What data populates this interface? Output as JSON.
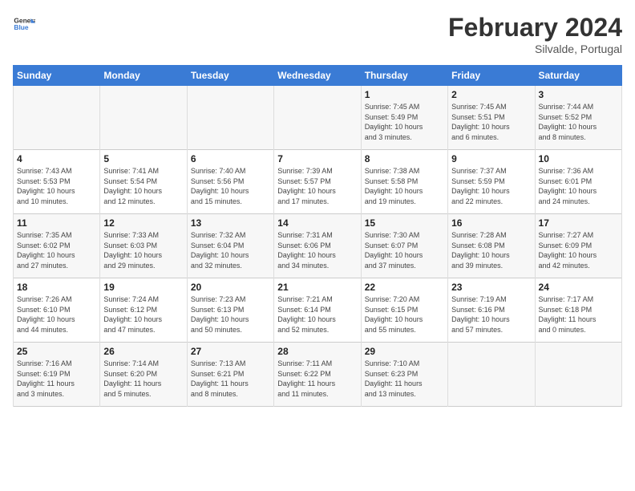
{
  "header": {
    "logo_general": "General",
    "logo_blue": "Blue",
    "month_title": "February 2024",
    "subtitle": "Silvalde, Portugal"
  },
  "weekdays": [
    "Sunday",
    "Monday",
    "Tuesday",
    "Wednesday",
    "Thursday",
    "Friday",
    "Saturday"
  ],
  "weeks": [
    [
      {
        "day": "",
        "info": ""
      },
      {
        "day": "",
        "info": ""
      },
      {
        "day": "",
        "info": ""
      },
      {
        "day": "",
        "info": ""
      },
      {
        "day": "1",
        "info": "Sunrise: 7:45 AM\nSunset: 5:49 PM\nDaylight: 10 hours\nand 3 minutes."
      },
      {
        "day": "2",
        "info": "Sunrise: 7:45 AM\nSunset: 5:51 PM\nDaylight: 10 hours\nand 6 minutes."
      },
      {
        "day": "3",
        "info": "Sunrise: 7:44 AM\nSunset: 5:52 PM\nDaylight: 10 hours\nand 8 minutes."
      }
    ],
    [
      {
        "day": "4",
        "info": "Sunrise: 7:43 AM\nSunset: 5:53 PM\nDaylight: 10 hours\nand 10 minutes."
      },
      {
        "day": "5",
        "info": "Sunrise: 7:41 AM\nSunset: 5:54 PM\nDaylight: 10 hours\nand 12 minutes."
      },
      {
        "day": "6",
        "info": "Sunrise: 7:40 AM\nSunset: 5:56 PM\nDaylight: 10 hours\nand 15 minutes."
      },
      {
        "day": "7",
        "info": "Sunrise: 7:39 AM\nSunset: 5:57 PM\nDaylight: 10 hours\nand 17 minutes."
      },
      {
        "day": "8",
        "info": "Sunrise: 7:38 AM\nSunset: 5:58 PM\nDaylight: 10 hours\nand 19 minutes."
      },
      {
        "day": "9",
        "info": "Sunrise: 7:37 AM\nSunset: 5:59 PM\nDaylight: 10 hours\nand 22 minutes."
      },
      {
        "day": "10",
        "info": "Sunrise: 7:36 AM\nSunset: 6:01 PM\nDaylight: 10 hours\nand 24 minutes."
      }
    ],
    [
      {
        "day": "11",
        "info": "Sunrise: 7:35 AM\nSunset: 6:02 PM\nDaylight: 10 hours\nand 27 minutes."
      },
      {
        "day": "12",
        "info": "Sunrise: 7:33 AM\nSunset: 6:03 PM\nDaylight: 10 hours\nand 29 minutes."
      },
      {
        "day": "13",
        "info": "Sunrise: 7:32 AM\nSunset: 6:04 PM\nDaylight: 10 hours\nand 32 minutes."
      },
      {
        "day": "14",
        "info": "Sunrise: 7:31 AM\nSunset: 6:06 PM\nDaylight: 10 hours\nand 34 minutes."
      },
      {
        "day": "15",
        "info": "Sunrise: 7:30 AM\nSunset: 6:07 PM\nDaylight: 10 hours\nand 37 minutes."
      },
      {
        "day": "16",
        "info": "Sunrise: 7:28 AM\nSunset: 6:08 PM\nDaylight: 10 hours\nand 39 minutes."
      },
      {
        "day": "17",
        "info": "Sunrise: 7:27 AM\nSunset: 6:09 PM\nDaylight: 10 hours\nand 42 minutes."
      }
    ],
    [
      {
        "day": "18",
        "info": "Sunrise: 7:26 AM\nSunset: 6:10 PM\nDaylight: 10 hours\nand 44 minutes."
      },
      {
        "day": "19",
        "info": "Sunrise: 7:24 AM\nSunset: 6:12 PM\nDaylight: 10 hours\nand 47 minutes."
      },
      {
        "day": "20",
        "info": "Sunrise: 7:23 AM\nSunset: 6:13 PM\nDaylight: 10 hours\nand 50 minutes."
      },
      {
        "day": "21",
        "info": "Sunrise: 7:21 AM\nSunset: 6:14 PM\nDaylight: 10 hours\nand 52 minutes."
      },
      {
        "day": "22",
        "info": "Sunrise: 7:20 AM\nSunset: 6:15 PM\nDaylight: 10 hours\nand 55 minutes."
      },
      {
        "day": "23",
        "info": "Sunrise: 7:19 AM\nSunset: 6:16 PM\nDaylight: 10 hours\nand 57 minutes."
      },
      {
        "day": "24",
        "info": "Sunrise: 7:17 AM\nSunset: 6:18 PM\nDaylight: 11 hours\nand 0 minutes."
      }
    ],
    [
      {
        "day": "25",
        "info": "Sunrise: 7:16 AM\nSunset: 6:19 PM\nDaylight: 11 hours\nand 3 minutes."
      },
      {
        "day": "26",
        "info": "Sunrise: 7:14 AM\nSunset: 6:20 PM\nDaylight: 11 hours\nand 5 minutes."
      },
      {
        "day": "27",
        "info": "Sunrise: 7:13 AM\nSunset: 6:21 PM\nDaylight: 11 hours\nand 8 minutes."
      },
      {
        "day": "28",
        "info": "Sunrise: 7:11 AM\nSunset: 6:22 PM\nDaylight: 11 hours\nand 11 minutes."
      },
      {
        "day": "29",
        "info": "Sunrise: 7:10 AM\nSunset: 6:23 PM\nDaylight: 11 hours\nand 13 minutes."
      },
      {
        "day": "",
        "info": ""
      },
      {
        "day": "",
        "info": ""
      }
    ]
  ]
}
